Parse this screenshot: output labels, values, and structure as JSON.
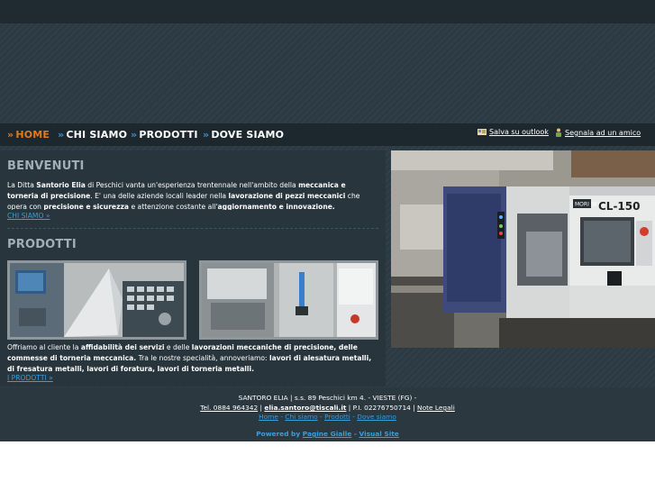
{
  "nav": {
    "items": [
      {
        "label": "HOME",
        "active": true
      },
      {
        "label": "CHI SIAMO",
        "active": false
      },
      {
        "label": "PRODOTTI",
        "active": false
      },
      {
        "label": "DOVE SIAMO",
        "active": false
      }
    ],
    "arrow": "»",
    "utility": {
      "outlook": {
        "label": "Salva su outlook",
        "icon": "outlook-card-icon"
      },
      "friend": {
        "label": "Segnala ad un amico",
        "icon": "person-icon"
      }
    }
  },
  "welcome": {
    "title": "BENVENUTI",
    "text": {
      "p1": "La Ditta ",
      "b1": "Santorio Elia",
      "p2": " di Peschici vanta un'esperienza trentennale nell'ambito della ",
      "b2": "meccanica e torneria di precisione",
      "p3": ". E' una delle aziende locali leader nella ",
      "b3": "lavorazione di pezzi meccanici",
      "p4": " che opera con ",
      "b4": "precisione e sicurezza",
      "p5": " e attenzione costante all'",
      "b5": "aggiornamento e innovazione."
    },
    "more": "CHI SIAMO »"
  },
  "products": {
    "title": "PRODOTTI",
    "text": {
      "p1": "Offriamo al cliente la ",
      "b1": "affidabilità dei servizi",
      "p2": " e delle ",
      "b2": "lavorazioni meccaniche di precisione, delle commesse di torneria meccanica.",
      "p3": " Tra le nostre specialità, annoveriamo: ",
      "b3": "lavori di alesatura metalli, di fresatura metalli, lavori di foratura, lavori di torneria metalli."
    },
    "more": "I PRODOTTI »"
  },
  "photo": {
    "machine_label": "CL-150",
    "brand_label": "MORI SEIKI"
  },
  "footer": {
    "line1": "SANTORO ELIA | s.s. 89 Peschici km 4. - VIESTE (FG) -",
    "tel": "Tel. 0884 964342",
    "sep1": " | ",
    "email": "elia.santoro@tiscali.it",
    "piva": " | P.I. 02276750714 | ",
    "legal": "Note Legali",
    "links": [
      "Home",
      "Chi siamo",
      "Prodotti",
      "Dove siamo"
    ],
    "link_sep": " - ",
    "powered_prefix": "Powered by ",
    "powered_a": "Pagine Gialle",
    "powered_sep": " - ",
    "powered_b": "Visual Site"
  }
}
